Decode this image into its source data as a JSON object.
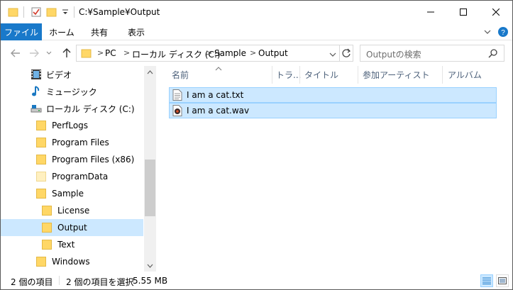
{
  "window": {
    "title": "C:¥Sample¥Output"
  },
  "ribbon": {
    "tabs": [
      {
        "label": "ファイル",
        "active": true
      },
      {
        "label": "ホーム",
        "active": false
      },
      {
        "label": "共有",
        "active": false
      },
      {
        "label": "表示",
        "active": false
      }
    ]
  },
  "address": {
    "breadcrumbs": [
      "PC",
      "ローカル ディスク (C:)",
      "Sample",
      "Output"
    ],
    "separator": ">"
  },
  "search": {
    "placeholder": "Outputの検索"
  },
  "nav": {
    "items": [
      {
        "label": "ビデオ",
        "icon": "video-icon",
        "selected": false
      },
      {
        "label": "ミュージック",
        "icon": "music-icon",
        "selected": false
      },
      {
        "label": "ローカル ディスク (C:)",
        "icon": "drive-icon",
        "selected": false
      },
      {
        "label": "PerfLogs",
        "icon": "folder-icon",
        "selected": false
      },
      {
        "label": "Program Files",
        "icon": "folder-icon",
        "selected": false
      },
      {
        "label": "Program Files (x86)",
        "icon": "folder-icon",
        "selected": false
      },
      {
        "label": "ProgramData",
        "icon": "folder-icon",
        "selected": false
      },
      {
        "label": "Sample",
        "icon": "folder-icon",
        "selected": false
      },
      {
        "label": "License",
        "icon": "folder-icon",
        "selected": false
      },
      {
        "label": "Output",
        "icon": "folder-icon",
        "selected": true
      },
      {
        "label": "Text",
        "icon": "folder-icon",
        "selected": false
      },
      {
        "label": "Windows",
        "icon": "folder-icon",
        "selected": false
      }
    ]
  },
  "columns": [
    "名前",
    "トラ...",
    "タイトル",
    "参加アーティスト",
    "アルバム"
  ],
  "files": [
    {
      "name": "I am a cat.txt",
      "icon": "text-file-icon"
    },
    {
      "name": "I am a cat.wav",
      "icon": "audio-file-icon"
    }
  ],
  "status": {
    "item_count": "2 個の項目",
    "selection": "2 個の項目を選択",
    "size": "5.55 MB"
  },
  "colors": {
    "accent": "#1979ca",
    "selection": "#cce8ff",
    "selection_border": "#99d1ff"
  }
}
